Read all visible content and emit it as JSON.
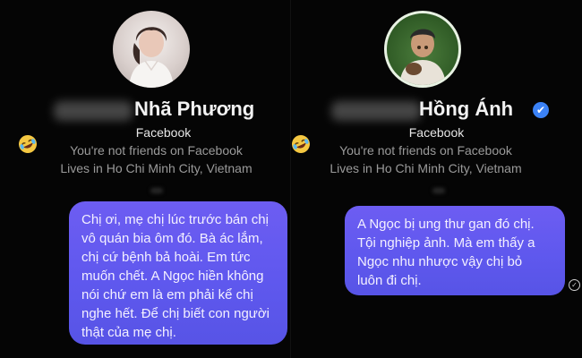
{
  "left": {
    "name": "Nhã Phương",
    "platform": "Facebook",
    "friend_status": "You're not friends on Facebook",
    "location": "Lives in Ho Chi Minh City, Vietnam",
    "message_lines": [
      "Chị ơi, mẹ chị lúc trước bán chị",
      "vô quán bia ôm đó. Bà ác lắm,",
      "chị cứ bệnh bả hoài. Em tức",
      "muốn chết. A Ngọc hiền không",
      "nói chứ em là em phải kể chị",
      "nghe hết. Để chị biết con người",
      "thật của mẹ chị."
    ]
  },
  "right": {
    "name": "Hồng Ánh",
    "verified_mark": "✔",
    "platform": "Facebook",
    "friend_status": "You're not friends on Facebook",
    "location": "Lives in Ho Chi Minh City, Vietnam",
    "message_lines": [
      "A Ngọc bị ung thư gan đó chị.",
      "Tội nghiệp ảnh. Mà em thấy a",
      "Ngọc nhu nhược vậy chị bỏ",
      "luôn đi chị."
    ],
    "seen_mark": "✓"
  },
  "icons": {
    "emoji": "rolling-on-the-floor-laughing",
    "verified": "verified-badge-icon",
    "seen": "check-circle-icon"
  },
  "colors": {
    "background": "#000000",
    "bubble": "#5f58ee",
    "verified": "#3b82f6"
  }
}
